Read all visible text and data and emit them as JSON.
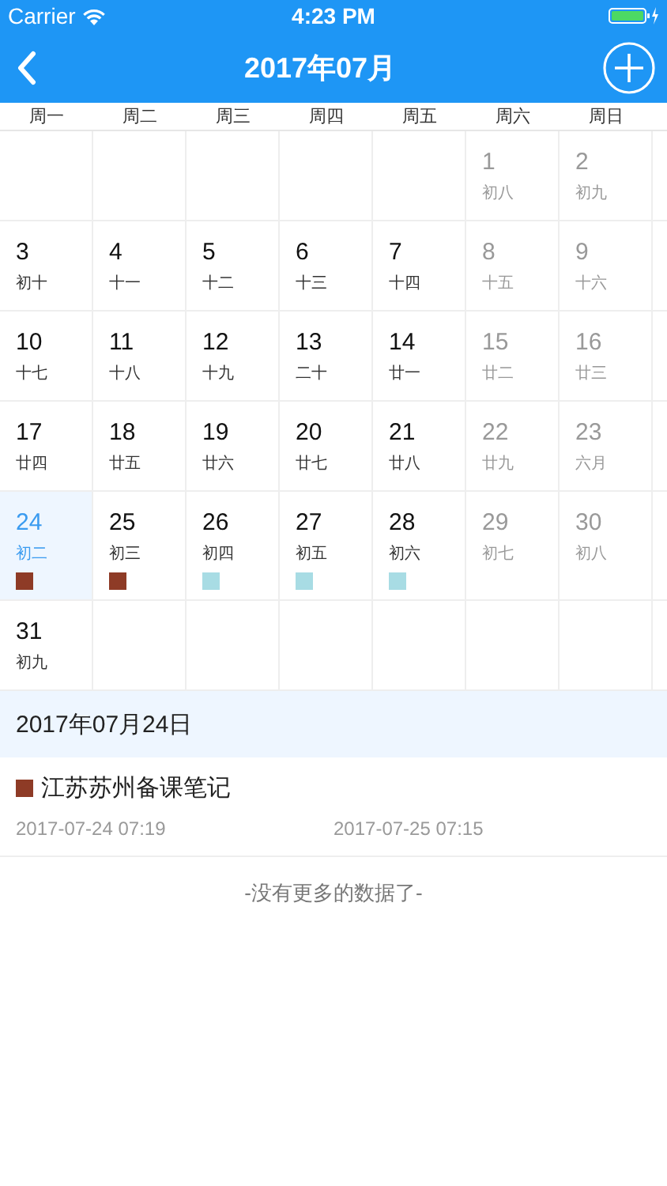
{
  "status_bar": {
    "carrier": "Carrier",
    "time": "4:23 PM"
  },
  "nav": {
    "title": "2017年07月"
  },
  "weekdays": [
    "周一",
    "周二",
    "周三",
    "周四",
    "周五",
    "周六",
    "周日"
  ],
  "weeks": [
    [
      {
        "kind": "empty"
      },
      {
        "kind": "empty"
      },
      {
        "kind": "empty"
      },
      {
        "kind": "empty"
      },
      {
        "kind": "empty"
      },
      {
        "kind": "day",
        "day": "1",
        "lunar": "初八",
        "dimmed": true,
        "selected": false
      },
      {
        "kind": "day",
        "day": "2",
        "lunar": "初九",
        "dimmed": true,
        "selected": false
      }
    ],
    [
      {
        "kind": "day",
        "day": "3",
        "lunar": "初十",
        "dimmed": false,
        "selected": false
      },
      {
        "kind": "day",
        "day": "4",
        "lunar": "十一",
        "dimmed": false,
        "selected": false
      },
      {
        "kind": "day",
        "day": "5",
        "lunar": "十二",
        "dimmed": false,
        "selected": false
      },
      {
        "kind": "day",
        "day": "6",
        "lunar": "十三",
        "dimmed": false,
        "selected": false
      },
      {
        "kind": "day",
        "day": "7",
        "lunar": "十四",
        "dimmed": false,
        "selected": false
      },
      {
        "kind": "day",
        "day": "8",
        "lunar": "十五",
        "dimmed": true,
        "selected": false
      },
      {
        "kind": "day",
        "day": "9",
        "lunar": "十六",
        "dimmed": true,
        "selected": false
      }
    ],
    [
      {
        "kind": "day",
        "day": "10",
        "lunar": "十七",
        "dimmed": false,
        "selected": false
      },
      {
        "kind": "day",
        "day": "11",
        "lunar": "十八",
        "dimmed": false,
        "selected": false
      },
      {
        "kind": "day",
        "day": "12",
        "lunar": "十九",
        "dimmed": false,
        "selected": false
      },
      {
        "kind": "day",
        "day": "13",
        "lunar": "二十",
        "dimmed": false,
        "selected": false
      },
      {
        "kind": "day",
        "day": "14",
        "lunar": "廿一",
        "dimmed": false,
        "selected": false
      },
      {
        "kind": "day",
        "day": "15",
        "lunar": "廿二",
        "dimmed": true,
        "selected": false
      },
      {
        "kind": "day",
        "day": "16",
        "lunar": "廿三",
        "dimmed": true,
        "selected": false
      }
    ],
    [
      {
        "kind": "day",
        "day": "17",
        "lunar": "廿四",
        "dimmed": false,
        "selected": false
      },
      {
        "kind": "day",
        "day": "18",
        "lunar": "廿五",
        "dimmed": false,
        "selected": false
      },
      {
        "kind": "day",
        "day": "19",
        "lunar": "廿六",
        "dimmed": false,
        "selected": false
      },
      {
        "kind": "day",
        "day": "20",
        "lunar": "廿七",
        "dimmed": false,
        "selected": false
      },
      {
        "kind": "day",
        "day": "21",
        "lunar": "廿八",
        "dimmed": false,
        "selected": false
      },
      {
        "kind": "day",
        "day": "22",
        "lunar": "廿九",
        "dimmed": true,
        "selected": false
      },
      {
        "kind": "day",
        "day": "23",
        "lunar": "六月",
        "dimmed": true,
        "selected": false
      }
    ],
    [
      {
        "kind": "day",
        "day": "24",
        "lunar": "初二",
        "dimmed": false,
        "selected": true,
        "color": "#8e3b26"
      },
      {
        "kind": "day",
        "day": "25",
        "lunar": "初三",
        "dimmed": false,
        "selected": false,
        "color": "#8e3b26"
      },
      {
        "kind": "day",
        "day": "26",
        "lunar": "初四",
        "dimmed": false,
        "selected": false,
        "color": "#a8dce4"
      },
      {
        "kind": "day",
        "day": "27",
        "lunar": "初五",
        "dimmed": false,
        "selected": false,
        "color": "#a8dce4"
      },
      {
        "kind": "day",
        "day": "28",
        "lunar": "初六",
        "dimmed": false,
        "selected": false,
        "color": "#a8dce4"
      },
      {
        "kind": "day",
        "day": "29",
        "lunar": "初七",
        "dimmed": true,
        "selected": false
      },
      {
        "kind": "day",
        "day": "30",
        "lunar": "初八",
        "dimmed": true,
        "selected": false
      }
    ],
    [
      {
        "kind": "day",
        "day": "31",
        "lunar": "初九",
        "dimmed": false,
        "selected": false
      },
      {
        "kind": "empty"
      },
      {
        "kind": "empty"
      },
      {
        "kind": "empty"
      },
      {
        "kind": "empty"
      },
      {
        "kind": "empty"
      },
      {
        "kind": "empty"
      }
    ]
  ],
  "selected_date": "2017年07月24日",
  "events": [
    {
      "title": "江苏苏州备课笔记",
      "color": "#8e3b26",
      "start": "2017-07-24 07:19",
      "end": "2017-07-25 07:15"
    }
  ],
  "footer": "-没有更多的数据了-"
}
